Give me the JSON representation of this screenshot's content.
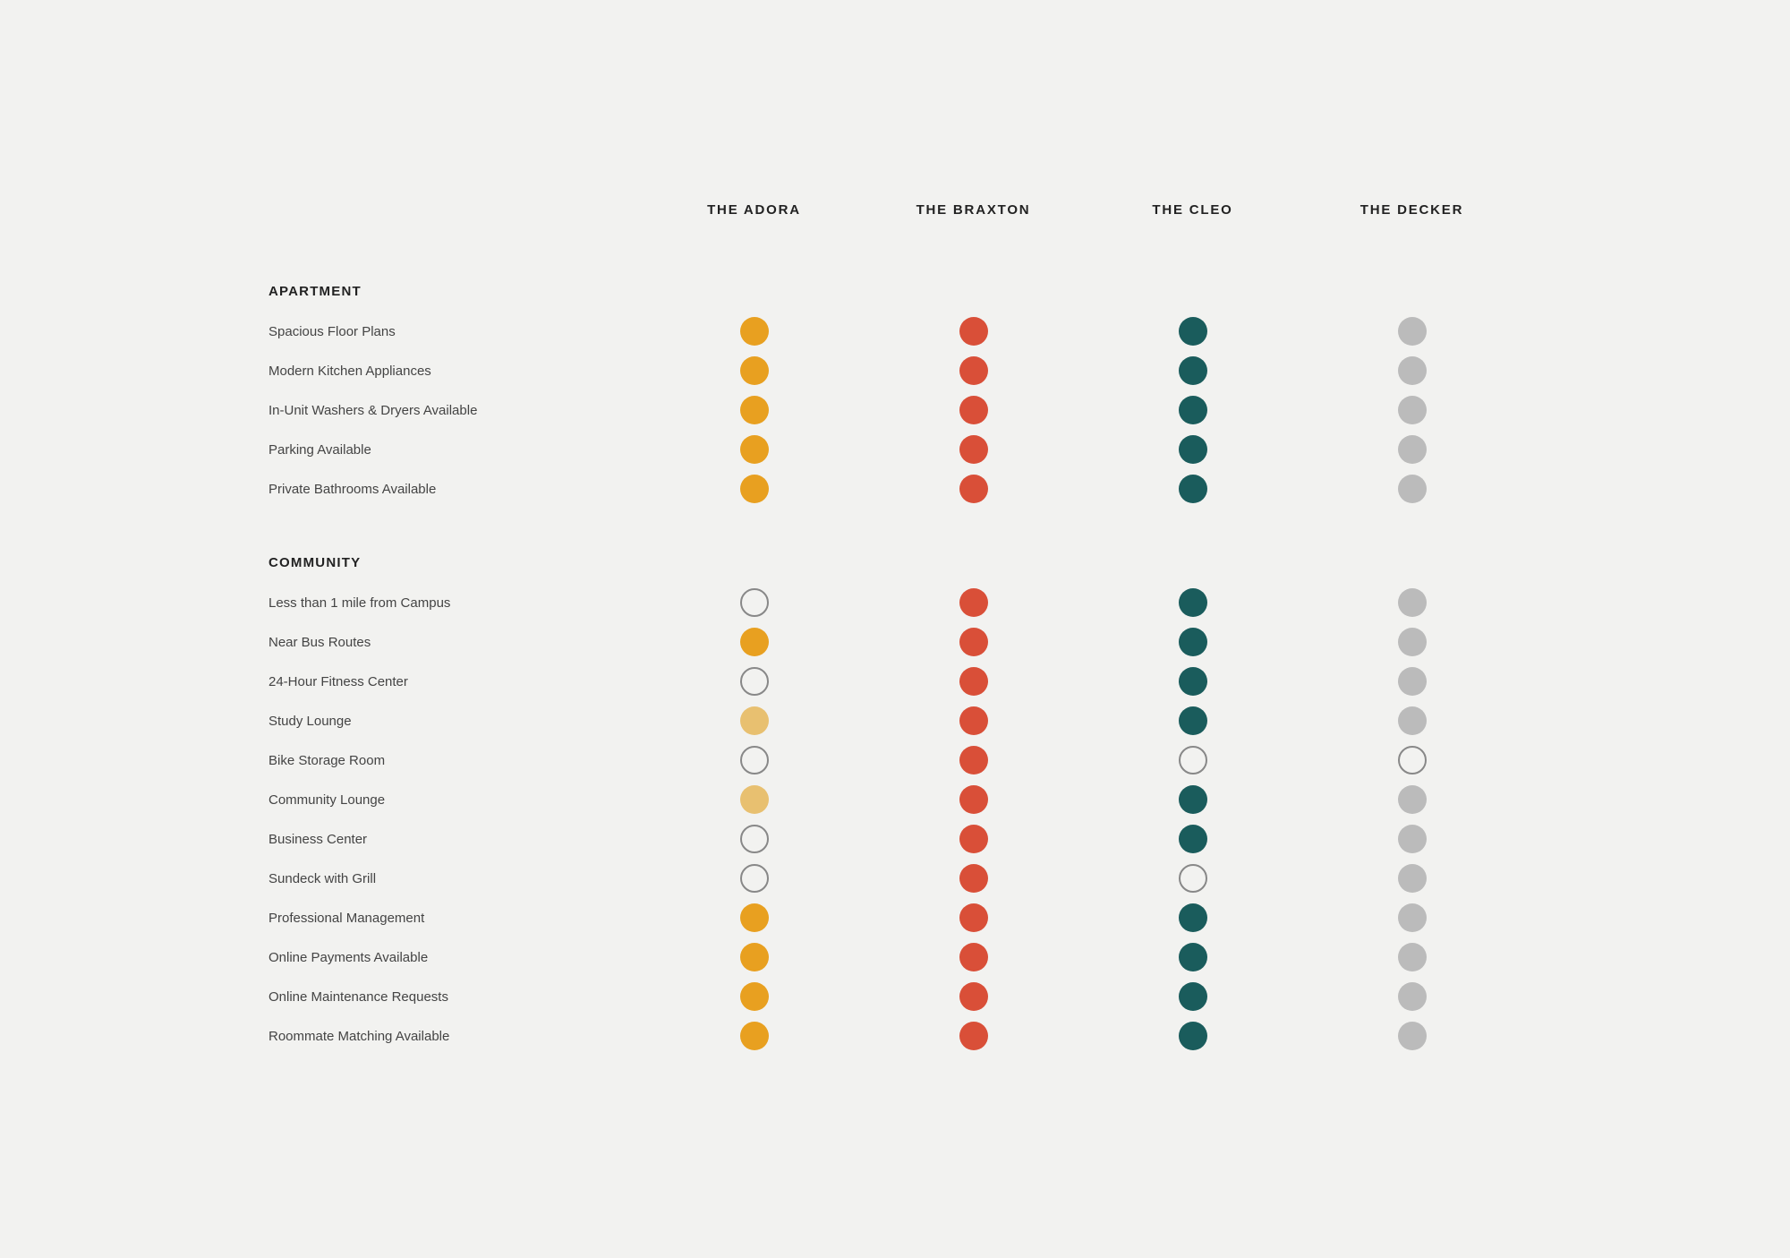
{
  "header": {
    "col1": "",
    "col2": "THE ADORA",
    "col3": "THE BRAXTON",
    "col4": "THE CLEO",
    "col5": "THE DECKER"
  },
  "sections": [
    {
      "label": "APARTMENT",
      "rows": [
        {
          "label": "Spacious Floor Plans",
          "adora": "filled",
          "braxton": "filled",
          "cleo": "filled",
          "decker": "filled"
        },
        {
          "label": "Modern Kitchen Appliances",
          "adora": "filled",
          "braxton": "filled",
          "cleo": "filled",
          "decker": "filled"
        },
        {
          "label": "In-Unit Washers & Dryers Available",
          "adora": "filled",
          "braxton": "filled",
          "cleo": "filled",
          "decker": "filled"
        },
        {
          "label": "Parking Available",
          "adora": "filled",
          "braxton": "filled",
          "cleo": "filled",
          "decker": "filled"
        },
        {
          "label": "Private Bathrooms Available",
          "adora": "filled",
          "braxton": "filled",
          "cleo": "filled",
          "decker": "filled"
        }
      ]
    },
    {
      "label": "COMMUNITY",
      "rows": [
        {
          "label": "Less than 1 mile from Campus",
          "adora": "empty",
          "braxton": "filled",
          "cleo": "filled",
          "decker": "filled"
        },
        {
          "label": "Near Bus Routes",
          "adora": "filled",
          "braxton": "filled",
          "cleo": "filled",
          "decker": "filled"
        },
        {
          "label": "24-Hour Fitness Center",
          "adora": "empty",
          "braxton": "filled",
          "cleo": "filled",
          "decker": "filled"
        },
        {
          "label": "Study Lounge",
          "adora": "filled-light",
          "braxton": "filled",
          "cleo": "filled",
          "decker": "filled"
        },
        {
          "label": "Bike Storage Room",
          "adora": "empty",
          "braxton": "filled",
          "cleo": "empty",
          "decker": "empty"
        },
        {
          "label": "Community Lounge",
          "adora": "filled-light",
          "braxton": "filled",
          "cleo": "filled",
          "decker": "filled"
        },
        {
          "label": "Business Center",
          "adora": "empty",
          "braxton": "filled",
          "cleo": "filled",
          "decker": "filled"
        },
        {
          "label": "Sundeck with Grill",
          "adora": "empty",
          "braxton": "filled",
          "cleo": "empty",
          "decker": "filled"
        },
        {
          "label": "Professional Management",
          "adora": "filled",
          "braxton": "filled",
          "cleo": "filled",
          "decker": "filled"
        },
        {
          "label": "Online Payments Available",
          "adora": "filled",
          "braxton": "filled",
          "cleo": "filled",
          "decker": "filled"
        },
        {
          "label": "Online Maintenance Requests",
          "adora": "filled",
          "braxton": "filled",
          "cleo": "filled",
          "decker": "filled"
        },
        {
          "label": "Roommate Matching Available",
          "adora": "filled",
          "braxton": "filled",
          "cleo": "filled",
          "decker": "filled"
        }
      ]
    }
  ]
}
